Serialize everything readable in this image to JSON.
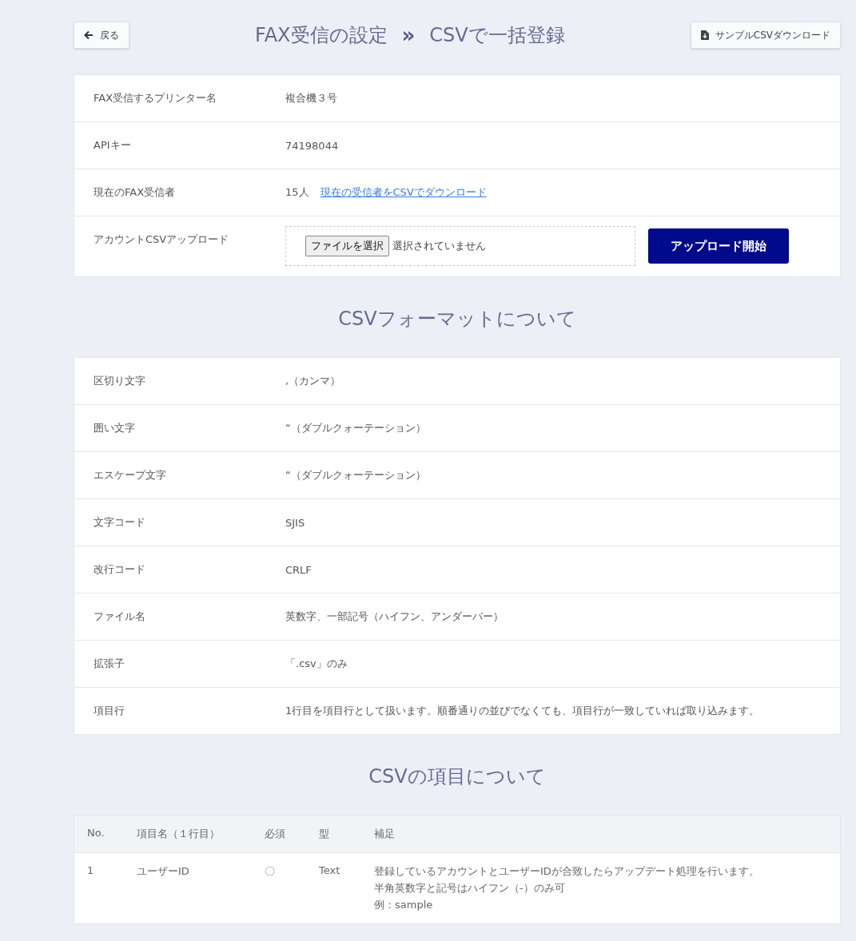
{
  "header": {
    "back_button": "戻る",
    "title": "FAX受信の設定",
    "separator": "»",
    "subtitle": "CSVで一括登録",
    "sample_button": "サンプルCSVダウンロード"
  },
  "settings": [
    {
      "kind": "text",
      "label": "FAX受信するプリンター名",
      "value": "複合機３号"
    },
    {
      "kind": "text",
      "label": "APIキー",
      "value": "74198044"
    },
    {
      "kind": "link",
      "label": "現在のFAX受信者",
      "value": "15人",
      "link": "現在の受信者をCSVでダウンロード"
    },
    {
      "kind": "upload",
      "label": "アカウントCSVアップロード",
      "file_button": "ファイルを選択",
      "file_status": "選択されていません",
      "submit": "アップロード開始"
    }
  ],
  "format_heading": "CSVフォーマットについて",
  "format": [
    {
      "label": "区切り文字",
      "value": ",（カンマ）"
    },
    {
      "label": "囲い文字",
      "value": "“（ダブルクォーテーション）"
    },
    {
      "label": "エスケープ文字",
      "value": "“（ダブルクォーテーション）"
    },
    {
      "label": "文字コード",
      "value": "SJIS"
    },
    {
      "label": "改行コード",
      "value": "CRLF"
    },
    {
      "label": "ファイル名",
      "value": "英数字、一部記号（ハイフン、アンダーバー）"
    },
    {
      "label": "拡張子",
      "value": "「.csv」のみ"
    },
    {
      "label": "項目行",
      "value": "1行目を項目行として扱います。順番通りの並びでなくても、項目行が一致していれば取り込みます。"
    }
  ],
  "fields_heading": "CSVの項目について",
  "table": {
    "columns": [
      "No.",
      "項目名（１行目）",
      "必須",
      "型",
      "補足"
    ],
    "rows": [
      {
        "no": "1",
        "name": "ユーザーID",
        "required": "〇",
        "type": "Text",
        "notes": [
          "登録しているアカウントとユーザーIDが合致したらアップデート処理を行います。",
          "半角英数字と記号はハイフン（-）のみ可",
          "例：sample"
        ]
      }
    ]
  }
}
